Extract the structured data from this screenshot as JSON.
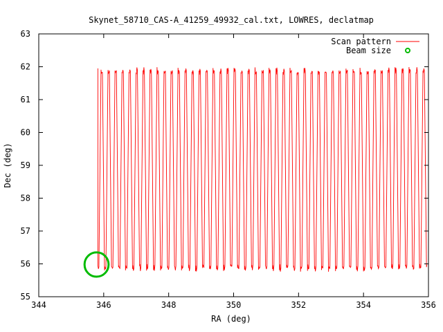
{
  "chart_data": {
    "type": "line",
    "title": "Skynet_58710_CAS-A_41259_49932_cal.txt, LOWRES, declatmap",
    "xlabel": "RA (deg)",
    "ylabel": "Dec (deg)",
    "xlim": [
      344,
      356
    ],
    "ylim": [
      55,
      63
    ],
    "xticks": [
      "344",
      "346",
      "348",
      "350",
      "352",
      "354",
      "356"
    ],
    "yticks": [
      "55",
      "56",
      "57",
      "58",
      "59",
      "60",
      "61",
      "62",
      "63"
    ],
    "grid": false,
    "legend_position": "top-right",
    "series": [
      {
        "name": "Scan pattern",
        "color": "#ff0000",
        "style": "line",
        "pattern": "raster scan in declination, alternating between the Dec limits",
        "ra_range": [
          345.82,
          355.95
        ],
        "dec_range": [
          55.8,
          61.95
        ],
        "num_sweeps": 94
      },
      {
        "name": "Beam size",
        "color": "#00bb00",
        "style": "circle",
        "center": [
          345.78,
          55.98
        ],
        "radius_deg": 0.37
      }
    ]
  }
}
